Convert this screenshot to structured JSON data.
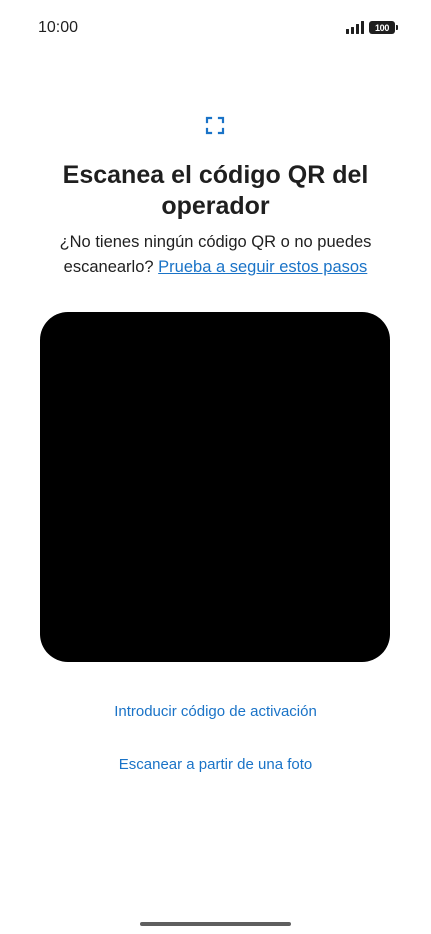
{
  "status_bar": {
    "time": "10:00",
    "battery": "100",
    "icons": [
      "signal-icon",
      "battery-icon"
    ]
  },
  "header": {
    "icon": "qr-scan-icon",
    "title": "Escanea el código QR del operador",
    "subtitle_text": "¿No tienes ningún código QR o no puedes escanearlo?",
    "help_link": "Prueba a seguir estos pasos"
  },
  "actions": {
    "enter_code": "Introducir código de activación",
    "scan_photo": "Escanear a partir de una foto"
  },
  "colors": {
    "accent": "#1a73c7",
    "text": "#1f1f1f",
    "background": "#ffffff",
    "camera": "#000000"
  }
}
